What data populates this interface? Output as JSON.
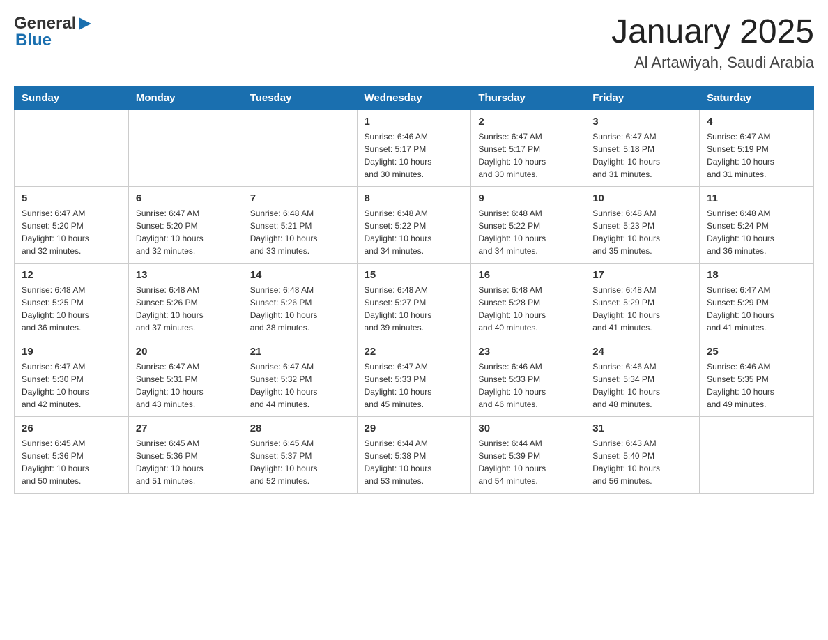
{
  "header": {
    "logo_text_general": "General",
    "logo_text_blue": "Blue",
    "month_title": "January 2025",
    "location": "Al Artawiyah, Saudi Arabia"
  },
  "days_of_week": [
    "Sunday",
    "Monday",
    "Tuesday",
    "Wednesday",
    "Thursday",
    "Friday",
    "Saturday"
  ],
  "weeks": [
    [
      {
        "day": "",
        "info": ""
      },
      {
        "day": "",
        "info": ""
      },
      {
        "day": "",
        "info": ""
      },
      {
        "day": "1",
        "info": "Sunrise: 6:46 AM\nSunset: 5:17 PM\nDaylight: 10 hours\nand 30 minutes."
      },
      {
        "day": "2",
        "info": "Sunrise: 6:47 AM\nSunset: 5:17 PM\nDaylight: 10 hours\nand 30 minutes."
      },
      {
        "day": "3",
        "info": "Sunrise: 6:47 AM\nSunset: 5:18 PM\nDaylight: 10 hours\nand 31 minutes."
      },
      {
        "day": "4",
        "info": "Sunrise: 6:47 AM\nSunset: 5:19 PM\nDaylight: 10 hours\nand 31 minutes."
      }
    ],
    [
      {
        "day": "5",
        "info": "Sunrise: 6:47 AM\nSunset: 5:20 PM\nDaylight: 10 hours\nand 32 minutes."
      },
      {
        "day": "6",
        "info": "Sunrise: 6:47 AM\nSunset: 5:20 PM\nDaylight: 10 hours\nand 32 minutes."
      },
      {
        "day": "7",
        "info": "Sunrise: 6:48 AM\nSunset: 5:21 PM\nDaylight: 10 hours\nand 33 minutes."
      },
      {
        "day": "8",
        "info": "Sunrise: 6:48 AM\nSunset: 5:22 PM\nDaylight: 10 hours\nand 34 minutes."
      },
      {
        "day": "9",
        "info": "Sunrise: 6:48 AM\nSunset: 5:22 PM\nDaylight: 10 hours\nand 34 minutes."
      },
      {
        "day": "10",
        "info": "Sunrise: 6:48 AM\nSunset: 5:23 PM\nDaylight: 10 hours\nand 35 minutes."
      },
      {
        "day": "11",
        "info": "Sunrise: 6:48 AM\nSunset: 5:24 PM\nDaylight: 10 hours\nand 36 minutes."
      }
    ],
    [
      {
        "day": "12",
        "info": "Sunrise: 6:48 AM\nSunset: 5:25 PM\nDaylight: 10 hours\nand 36 minutes."
      },
      {
        "day": "13",
        "info": "Sunrise: 6:48 AM\nSunset: 5:26 PM\nDaylight: 10 hours\nand 37 minutes."
      },
      {
        "day": "14",
        "info": "Sunrise: 6:48 AM\nSunset: 5:26 PM\nDaylight: 10 hours\nand 38 minutes."
      },
      {
        "day": "15",
        "info": "Sunrise: 6:48 AM\nSunset: 5:27 PM\nDaylight: 10 hours\nand 39 minutes."
      },
      {
        "day": "16",
        "info": "Sunrise: 6:48 AM\nSunset: 5:28 PM\nDaylight: 10 hours\nand 40 minutes."
      },
      {
        "day": "17",
        "info": "Sunrise: 6:48 AM\nSunset: 5:29 PM\nDaylight: 10 hours\nand 41 minutes."
      },
      {
        "day": "18",
        "info": "Sunrise: 6:47 AM\nSunset: 5:29 PM\nDaylight: 10 hours\nand 41 minutes."
      }
    ],
    [
      {
        "day": "19",
        "info": "Sunrise: 6:47 AM\nSunset: 5:30 PM\nDaylight: 10 hours\nand 42 minutes."
      },
      {
        "day": "20",
        "info": "Sunrise: 6:47 AM\nSunset: 5:31 PM\nDaylight: 10 hours\nand 43 minutes."
      },
      {
        "day": "21",
        "info": "Sunrise: 6:47 AM\nSunset: 5:32 PM\nDaylight: 10 hours\nand 44 minutes."
      },
      {
        "day": "22",
        "info": "Sunrise: 6:47 AM\nSunset: 5:33 PM\nDaylight: 10 hours\nand 45 minutes."
      },
      {
        "day": "23",
        "info": "Sunrise: 6:46 AM\nSunset: 5:33 PM\nDaylight: 10 hours\nand 46 minutes."
      },
      {
        "day": "24",
        "info": "Sunrise: 6:46 AM\nSunset: 5:34 PM\nDaylight: 10 hours\nand 48 minutes."
      },
      {
        "day": "25",
        "info": "Sunrise: 6:46 AM\nSunset: 5:35 PM\nDaylight: 10 hours\nand 49 minutes."
      }
    ],
    [
      {
        "day": "26",
        "info": "Sunrise: 6:45 AM\nSunset: 5:36 PM\nDaylight: 10 hours\nand 50 minutes."
      },
      {
        "day": "27",
        "info": "Sunrise: 6:45 AM\nSunset: 5:36 PM\nDaylight: 10 hours\nand 51 minutes."
      },
      {
        "day": "28",
        "info": "Sunrise: 6:45 AM\nSunset: 5:37 PM\nDaylight: 10 hours\nand 52 minutes."
      },
      {
        "day": "29",
        "info": "Sunrise: 6:44 AM\nSunset: 5:38 PM\nDaylight: 10 hours\nand 53 minutes."
      },
      {
        "day": "30",
        "info": "Sunrise: 6:44 AM\nSunset: 5:39 PM\nDaylight: 10 hours\nand 54 minutes."
      },
      {
        "day": "31",
        "info": "Sunrise: 6:43 AM\nSunset: 5:40 PM\nDaylight: 10 hours\nand 56 minutes."
      },
      {
        "day": "",
        "info": ""
      }
    ]
  ]
}
